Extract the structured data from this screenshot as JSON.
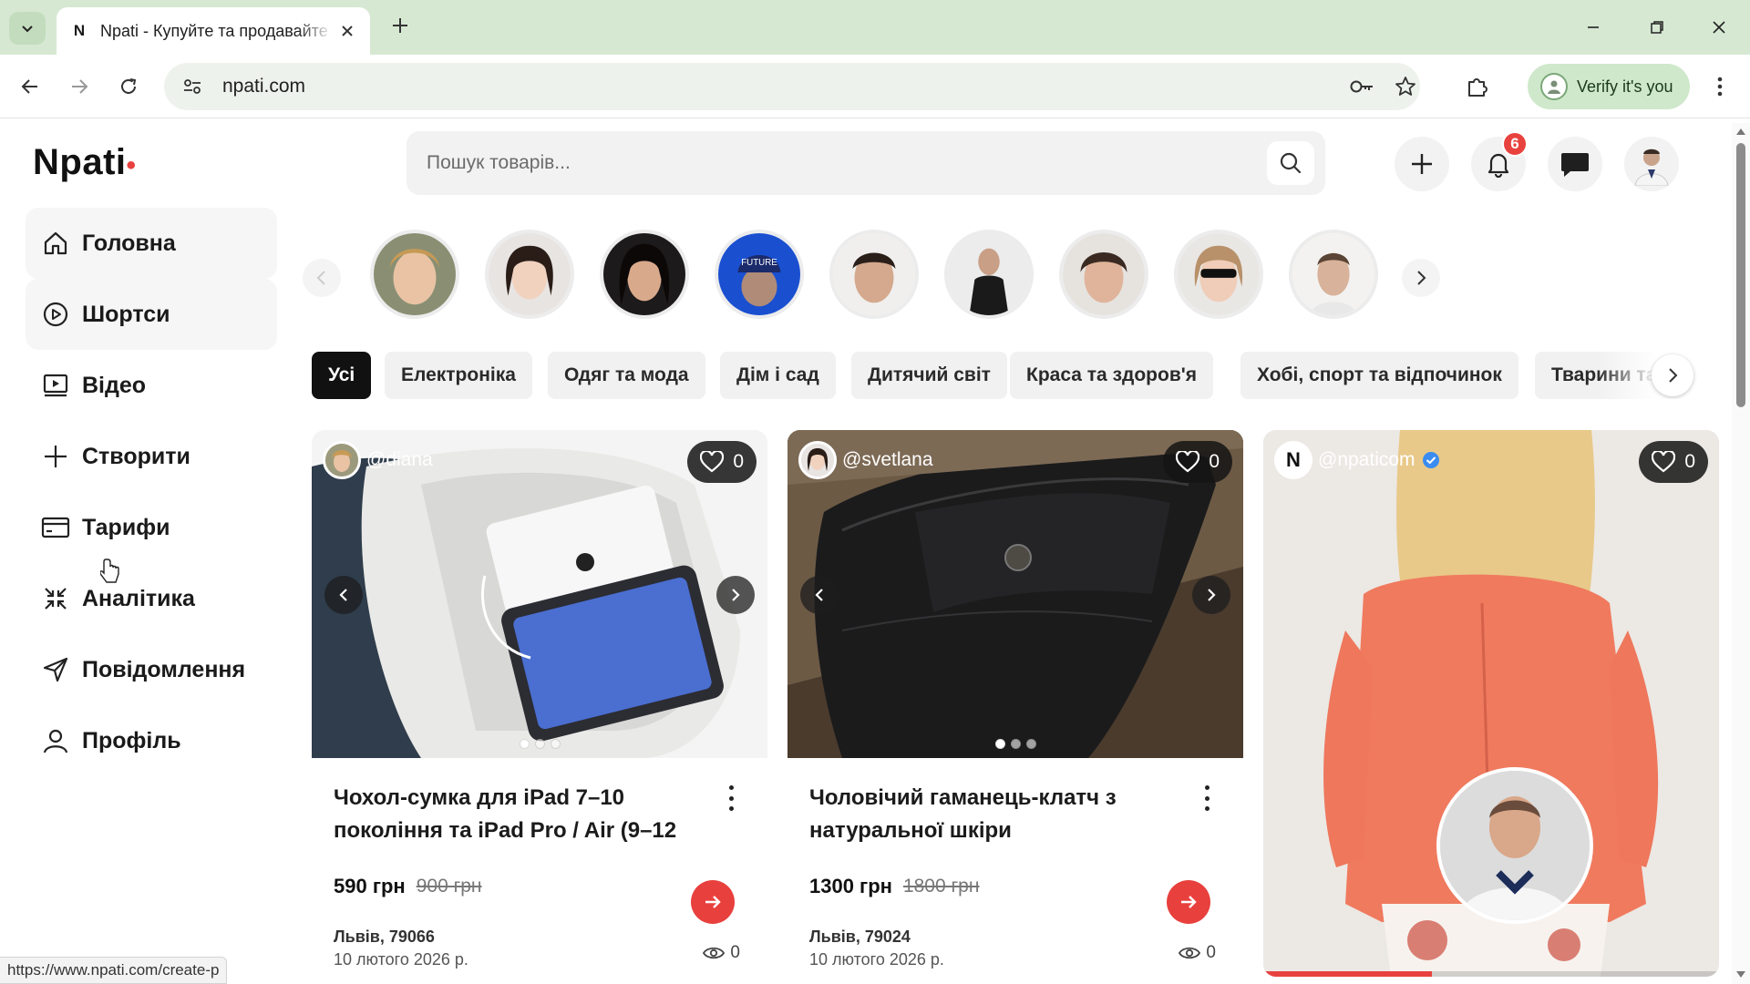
{
  "browser": {
    "tab_title": "Npati - Купуйте та продавайте",
    "tab_favicon": "N",
    "url": "npati.com",
    "verify_label": "Verify it's you",
    "status_url": "https://www.npati.com/create-p"
  },
  "header": {
    "logo": "Npati",
    "logo_dot": "•",
    "search_placeholder": "Пошук товарів...",
    "notifications_count": "6"
  },
  "sidebar": {
    "items": [
      {
        "label": "Головна",
        "icon": "home-icon"
      },
      {
        "label": "Шортси",
        "icon": "play-circle-icon"
      },
      {
        "label": "Відео",
        "icon": "video-icon"
      },
      {
        "label": "Створити",
        "icon": "plus-icon"
      },
      {
        "label": "Тарифи",
        "icon": "card-icon"
      },
      {
        "label": "Аналітика",
        "icon": "analytics-icon"
      },
      {
        "label": "Повідомлення",
        "icon": "send-icon"
      },
      {
        "label": "Профіль",
        "icon": "user-icon"
      }
    ]
  },
  "categories": [
    "Усі",
    "Електроніка",
    "Одяг та мода",
    "Дім і сад",
    "Дитячий світ",
    "Краса та здоров'я",
    "Хобі, спорт та відпочинок",
    "Тварини та з"
  ],
  "products": [
    {
      "user": "@diana",
      "likes": "0",
      "title": "Чохол-сумка для iPad 7–10 покоління та iPad Pro / Air (9–12",
      "price": "590 грн",
      "old_price": "900 грн",
      "location": "Львів, 79066",
      "date": "10 лютого 2026 р.",
      "views": "0"
    },
    {
      "user": "@svetlana",
      "likes": "0",
      "title": "Чоловічий гаманець-клатч з натуральної шкіри",
      "price": "1300 грн",
      "old_price": "1800 грн",
      "location": "Львів, 79024",
      "date": "10 лютого 2026 р.",
      "views": "0"
    }
  ],
  "video": {
    "user": "@npaticom",
    "avatar_letter": "N",
    "likes": "0",
    "progress": 0.37
  },
  "colors": {
    "accent": "#e8423f",
    "chrome": "#d6e8d2"
  }
}
